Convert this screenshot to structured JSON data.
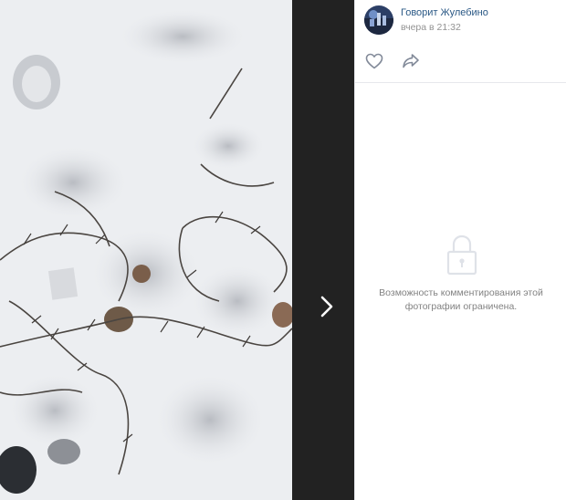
{
  "post": {
    "author": "Говорит Жулебино",
    "date": "вчера в 21:32"
  },
  "icons": {
    "like": "heart-outline-icon",
    "share": "share-arrow-icon",
    "next": "chevron-right-icon",
    "lock": "lock-icon"
  },
  "comments": {
    "closed_message": "Возможность комментирования этой фотографии ограничена."
  },
  "colors": {
    "link": "#2a5885",
    "muted": "#939393",
    "icon": "#828a99",
    "viewer_bg": "#222222"
  }
}
